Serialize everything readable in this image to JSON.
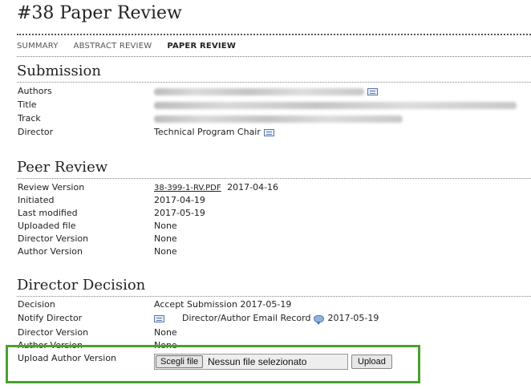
{
  "page": {
    "title": "#38 Paper Review"
  },
  "tabs": [
    {
      "label": "Summary",
      "active": false
    },
    {
      "label": "Abstract Review",
      "active": false
    },
    {
      "label": "Paper Review",
      "active": true
    }
  ],
  "submission": {
    "heading": "Submission",
    "rows": [
      {
        "label": "Authors",
        "value": "",
        "icon": "mail-icon"
      },
      {
        "label": "Title",
        "value": ""
      },
      {
        "label": "Track",
        "value": ""
      },
      {
        "label": "Director",
        "value": "Technical Program Chair",
        "icon": "mail-icon"
      }
    ]
  },
  "peer_review": {
    "heading": "Peer Review",
    "review_version_label": "Review Version",
    "review_version_file": "38-399-1-RV.PDF",
    "review_version_date": "2017-04-16",
    "rows": [
      {
        "label": "Initiated",
        "value": "2017-04-19"
      },
      {
        "label": "Last modified",
        "value": "2017-05-19"
      },
      {
        "label": "Uploaded file",
        "value": "None"
      },
      {
        "label": "Director Version",
        "value": "None"
      },
      {
        "label": "Author Version",
        "value": "None"
      }
    ]
  },
  "director_decision": {
    "heading": "Director Decision",
    "decision_label": "Decision",
    "decision_value": "Accept Submission 2017-05-19",
    "notify_label": "Notify Director",
    "email_record": "Director/Author Email Record",
    "email_record_date": "2017-05-19",
    "director_version_label": "Director Version",
    "director_version_value": "None",
    "author_version_label": "Author Version",
    "author_version_value": "None",
    "upload_label": "Upload Author Version",
    "choose_file_label": "Scegli file",
    "no_file_text": "Nessun file selezionato",
    "upload_button": "Upload"
  },
  "colors": {
    "highlight": "#4aa02c"
  }
}
